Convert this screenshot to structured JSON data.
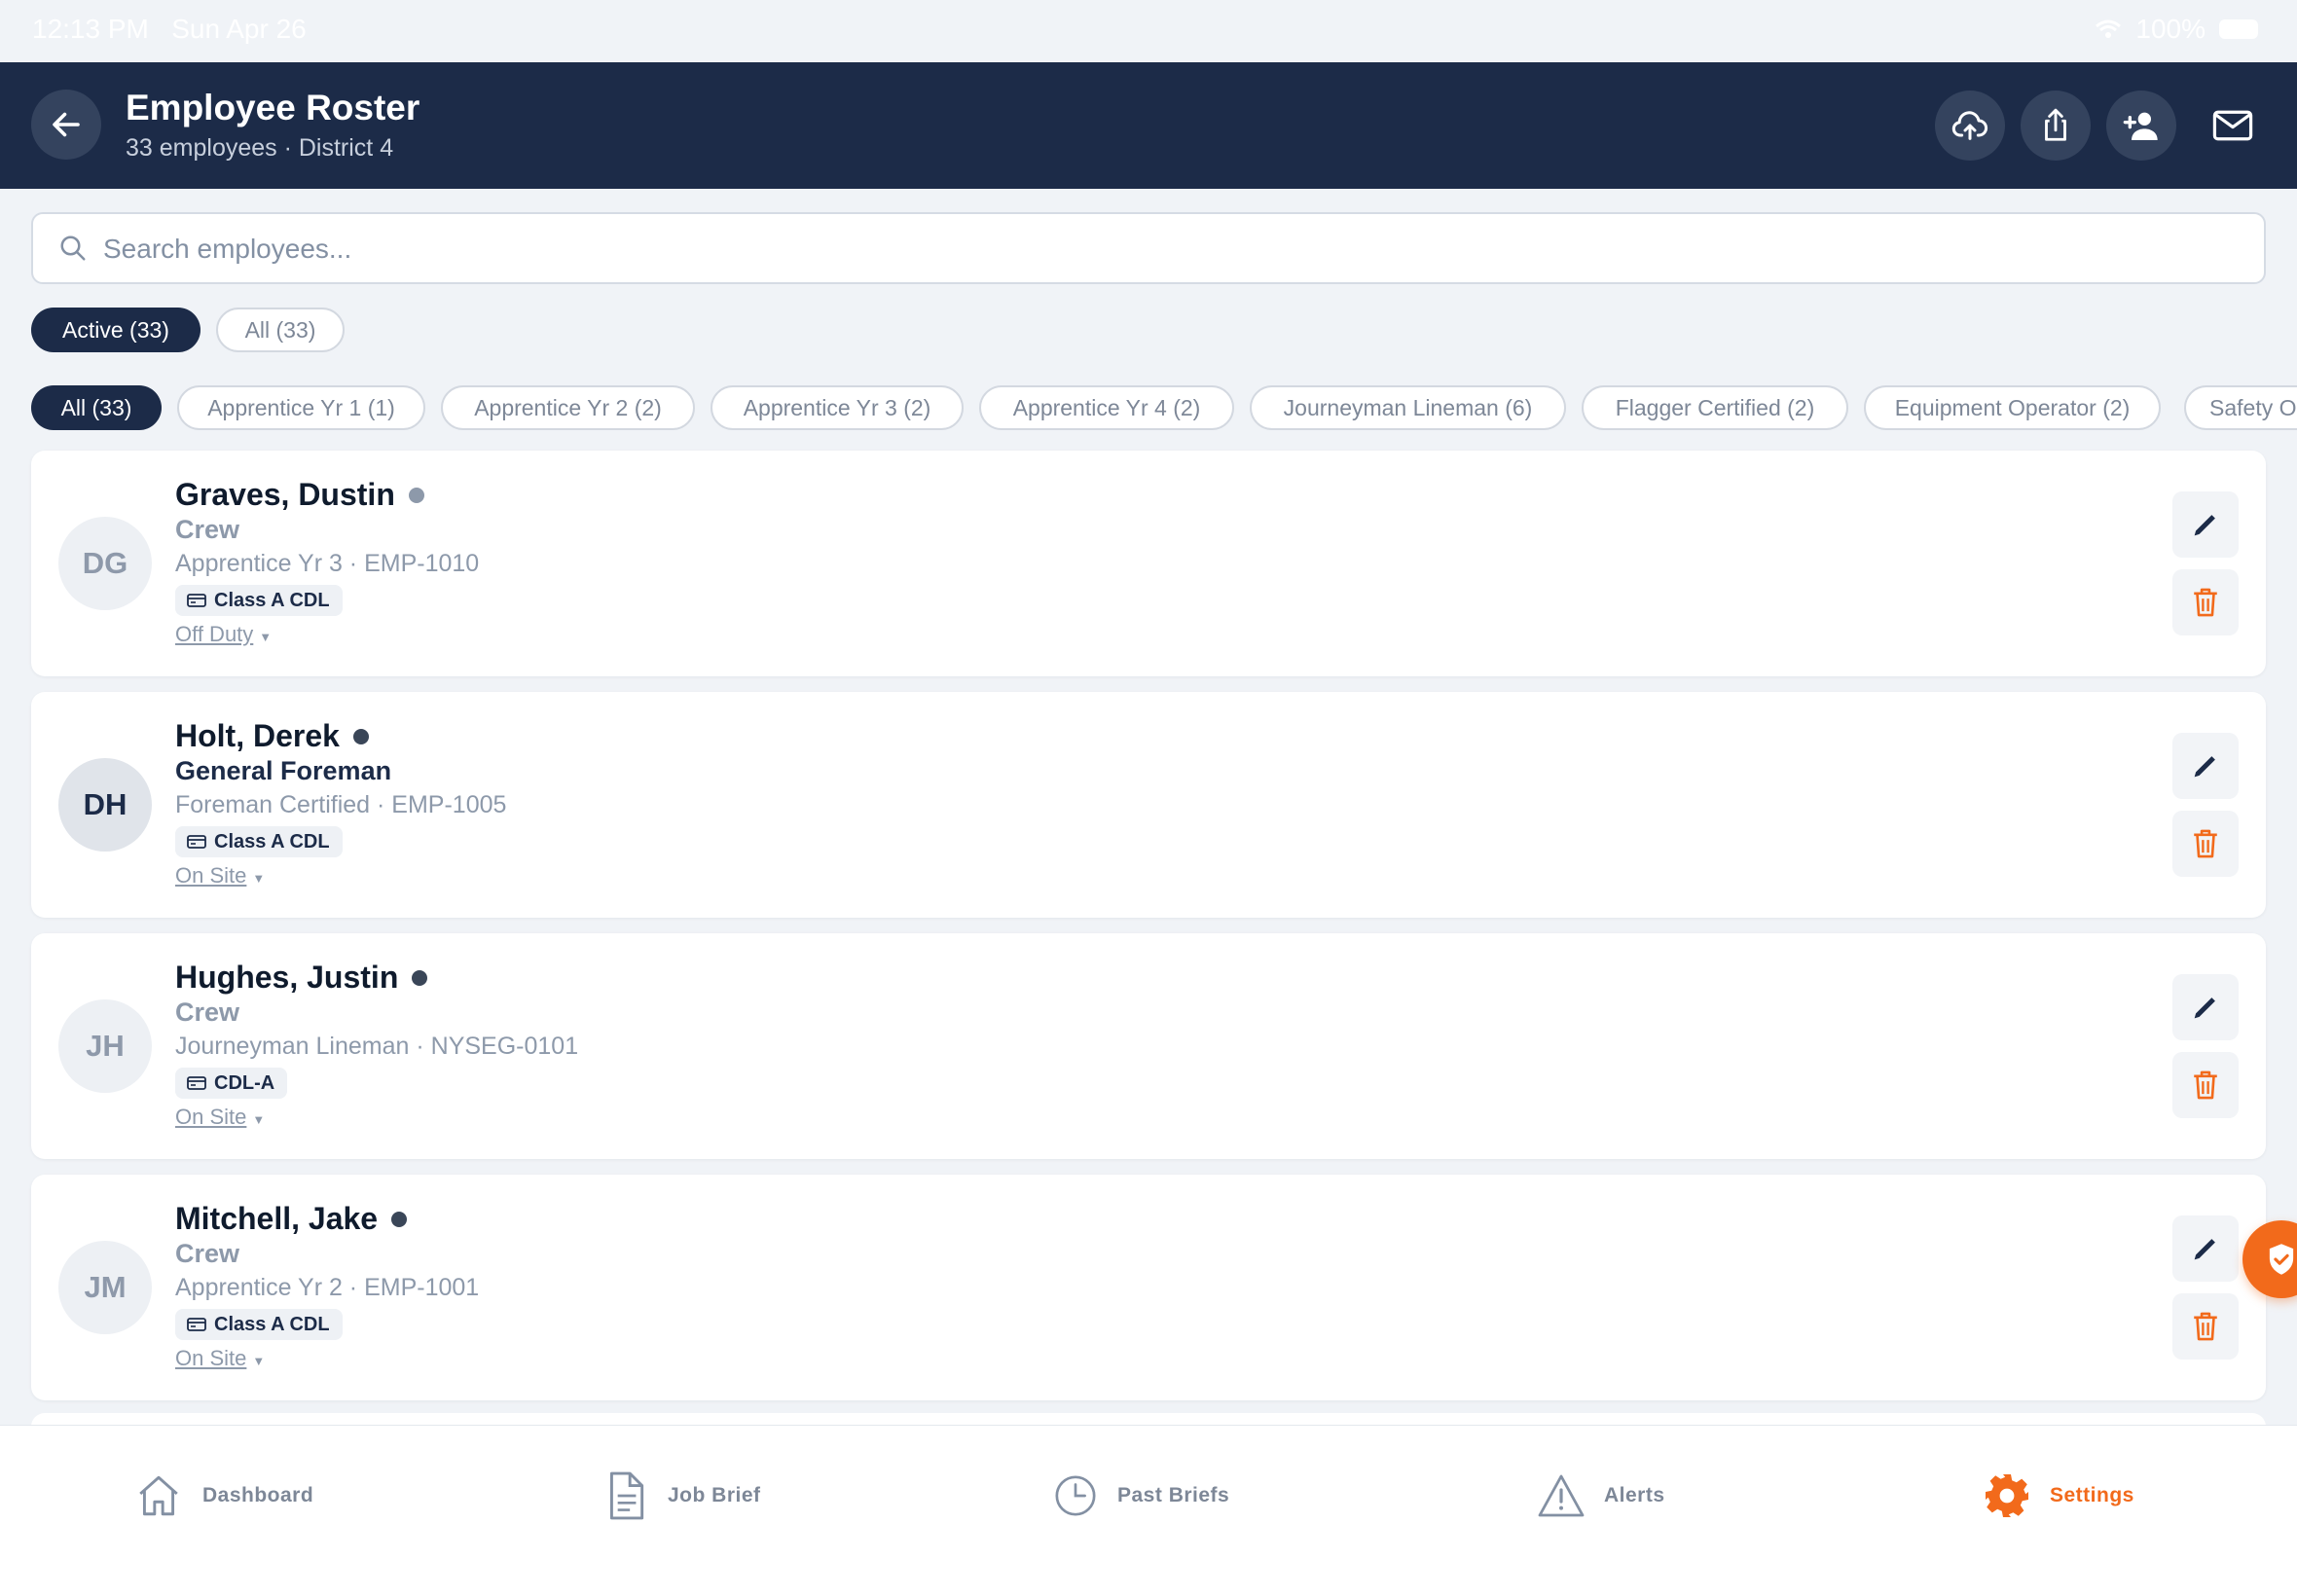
{
  "status_bar": {
    "time": "12:13 PM",
    "date": "Sun Apr 26",
    "battery": "100%"
  },
  "header": {
    "title": "Employee Roster",
    "subtitle": "33 employees · District 4",
    "icons": [
      "back-arrow-icon",
      "cloud-upload-icon",
      "share-icon",
      "add-person-icon",
      "mail-icon"
    ]
  },
  "search": {
    "placeholder": "Search employees...",
    "value": ""
  },
  "status_filters": [
    {
      "label": "Active (33)",
      "selected": true
    },
    {
      "label": "All (33)",
      "selected": false
    }
  ],
  "role_filters": [
    {
      "label": "All (33)",
      "selected": true
    },
    {
      "label": "Apprentice Yr 1 (1)",
      "selected": false
    },
    {
      "label": "Apprentice Yr 2 (2)",
      "selected": false
    },
    {
      "label": "Apprentice Yr 3 (2)",
      "selected": false
    },
    {
      "label": "Apprentice Yr 4 (2)",
      "selected": false
    },
    {
      "label": "Journeyman Lineman (6)",
      "selected": false
    },
    {
      "label": "Flagger Certified (2)",
      "selected": false
    },
    {
      "label": "Equipment Operator (2)",
      "selected": false
    },
    {
      "label": "Safety O",
      "selected": false
    }
  ],
  "employees": [
    {
      "initials": "DG",
      "name": "Graves, Dustin",
      "role": "Crew",
      "detail": "Apprentice Yr 3 · EMP-1010",
      "license": "Class A CDL",
      "status": "Off Duty"
    },
    {
      "initials": "DH",
      "name": "Holt, Derek",
      "role": "General Foreman",
      "detail": "Foreman Certified · EMP-1005",
      "license": "Class A CDL",
      "status": "On Site"
    },
    {
      "initials": "JH",
      "name": "Hughes, Justin",
      "role": "Crew",
      "detail": "Journeyman Lineman · NYSEG-0101",
      "license": "CDL-A",
      "status": "On Site"
    },
    {
      "initials": "JM",
      "name": "Mitchell, Jake",
      "role": "Crew",
      "detail": "Apprentice Yr 2 · EMP-1001",
      "license": "Class A CDL",
      "status": "On Site"
    }
  ],
  "tabs": [
    {
      "label": "Dashboard",
      "icon": "home-icon",
      "active": false
    },
    {
      "label": "Job Brief",
      "icon": "document-icon",
      "active": false
    },
    {
      "label": "Past Briefs",
      "icon": "clock-icon",
      "active": false
    },
    {
      "label": "Alerts",
      "icon": "warning-icon",
      "active": false
    },
    {
      "label": "Settings",
      "icon": "gear-icon",
      "active": true
    }
  ],
  "colors": {
    "navy": "#1c2b48",
    "accent": "#f26a1b",
    "muted": "#8d99aa",
    "background": "#f0f3f7"
  }
}
